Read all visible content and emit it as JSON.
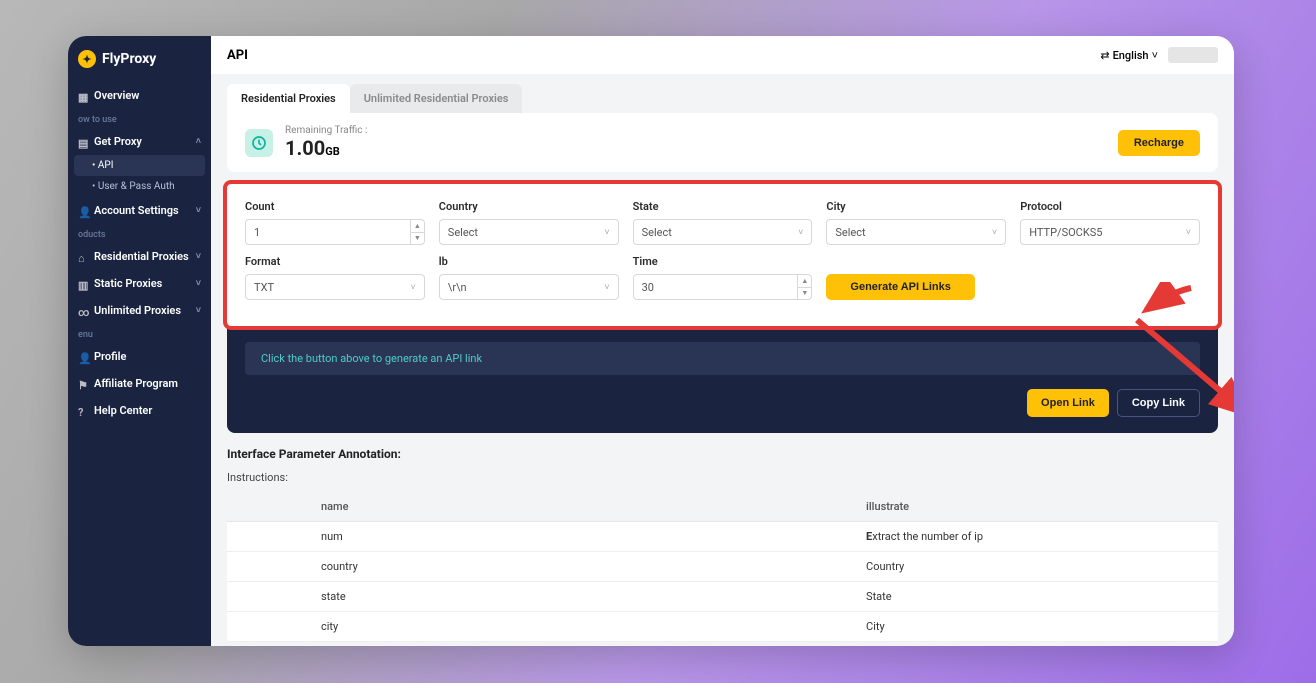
{
  "brand": "FlyProxy",
  "header": {
    "title": "API",
    "language": "English"
  },
  "sidebar": {
    "overview": "Overview",
    "sections": {
      "how": "ow to use",
      "products": "oducts",
      "menu": "enu"
    },
    "getProxy": "Get Proxy",
    "subs": {
      "api": "API",
      "userPass": "User & Pass Auth"
    },
    "accountSettings": "Account Settings",
    "residential": "Residential Proxies",
    "static": "Static Proxies",
    "unlimited": "Unlimited Proxies",
    "profile": "Profile",
    "affiliate": "Affiliate Program",
    "help": "Help Center"
  },
  "tabs": {
    "residential": "Residential Proxies",
    "unlimited": "Unlimited Residential Proxies"
  },
  "traffic": {
    "label": "Remaining Traffic :",
    "value": "1.00",
    "unit": "GB",
    "recharge": "Recharge"
  },
  "form": {
    "count": {
      "label": "Count",
      "value": "1"
    },
    "country": {
      "label": "Country",
      "value": "Select"
    },
    "state": {
      "label": "State",
      "value": "Select"
    },
    "city": {
      "label": "City",
      "value": "Select"
    },
    "protocol": {
      "label": "Protocol",
      "value": "HTTP/SOCKS5"
    },
    "format": {
      "label": "Format",
      "value": "TXT"
    },
    "lb": {
      "label": "lb",
      "value": "\\r\\n"
    },
    "time": {
      "label": "Time",
      "value": "30"
    },
    "generate": "Generate API Links"
  },
  "result": {
    "hint": "Click the button above to generate an API link",
    "open": "Open Link",
    "copy": "Copy Link"
  },
  "annotation": {
    "title": "Interface Parameter Annotation:",
    "instructions": "Instructions:",
    "headers": {
      "name": "name",
      "illustrate": "illustrate"
    },
    "rows": [
      {
        "name": "num",
        "desc": "Extract the number of ip"
      },
      {
        "name": "country",
        "desc": "Country"
      },
      {
        "name": "state",
        "desc": "State"
      },
      {
        "name": "city",
        "desc": "City"
      }
    ]
  }
}
